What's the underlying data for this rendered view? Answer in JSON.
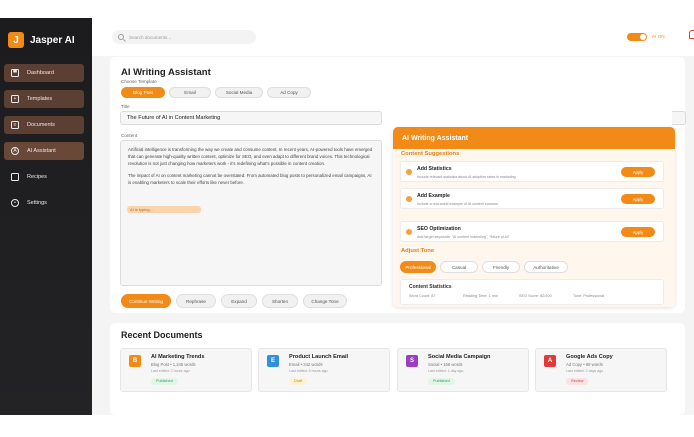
{
  "app": {
    "brand_initial": "J",
    "brand_name": "Jasper AI"
  },
  "colors": {
    "accent": "#f28a18",
    "sidebar_bg": "#1c1c1e",
    "nav_active": "#6a4838"
  },
  "sidebar": {
    "items": [
      {
        "label": "Dashboard",
        "icon": "dashboard-icon"
      },
      {
        "label": "Templates",
        "icon": "plus-square-icon"
      },
      {
        "label": "Documents",
        "icon": "document-icon"
      },
      {
        "label": "AI Assistant",
        "icon": "ai-icon"
      },
      {
        "label": "Recipes",
        "icon": "recipe-icon"
      },
      {
        "label": "Settings",
        "icon": "gear-icon"
      }
    ]
  },
  "topbar": {
    "search_placeholder": "Search documents...",
    "ai_toggle_label": "AI ON",
    "ai_toggle_on": true
  },
  "assistant": {
    "title": "AI Writing Assistant",
    "choose_template_label": "Choose Template",
    "templates": [
      "Blog Post",
      "Email",
      "Social Media",
      "Ad Copy"
    ],
    "selected_template": "Blog Post",
    "title_label": "Title",
    "title_value": "The Future of AI in Content Marketing",
    "content_label": "Content",
    "content_p1": "Artificial intelligence is transforming the way we create and consume content. In recent years, AI-powered tools have emerged that can generate high-quality written content, optimize for SEO, and even adapt to different brand voices. This technological revolution is not just changing how marketers work - it's redefining what's possible in content creation.",
    "content_p2": "The impact of AI on content marketing cannot be overstated. From automated blog posts to personalized email campaigns, AI is enabling marketers to scale their efforts like never before.",
    "typing_indicator": "AI is typing...",
    "actions": [
      "Continue Writing",
      "Rephrase",
      "Expand",
      "Shorten",
      "Change Tone"
    ]
  },
  "panel": {
    "title": "AI Writing Assistant",
    "suggestions_heading": "Content Suggestions",
    "suggestions": [
      {
        "title": "Add Statistics",
        "desc": "Include relevant statistics about AI adoption rates in marketing",
        "button": "Apply"
      },
      {
        "title": "Add Example",
        "desc": "Include a real-world example of AI content success",
        "button": "Apply"
      },
      {
        "title": "SEO Optimization",
        "desc": "Add target keywords: \"AI content marketing\", \"future of AI\"",
        "button": "Apply"
      }
    ],
    "tone_heading": "Adjust Tone",
    "tones": [
      "Professional",
      "Casual",
      "Friendly",
      "Authoritative"
    ],
    "selected_tone": "Professional",
    "stats_title": "Content Statistics",
    "stats": [
      "Word Count: 87",
      "Reading Time: 1 min",
      "SEO Score: 82/100",
      "Tone: Professional"
    ]
  },
  "recent": {
    "title": "Recent Documents",
    "docs": [
      {
        "icon_letter": "B",
        "icon_color": "#f28a18",
        "title": "AI Marketing Trends",
        "meta": "Blog Post • 1,245 words",
        "edited": "Last edited: 2 hours ago",
        "badge": "Published",
        "badge_bg": "#e2f5e6",
        "badge_fg": "#3a9a52"
      },
      {
        "icon_letter": "E",
        "icon_color": "#2f8fe0",
        "title": "Product Launch Email",
        "meta": "Email • 342 words",
        "edited": "Last edited: 5 hours ago",
        "badge": "Draft",
        "badge_bg": "#fff1d6",
        "badge_fg": "#c98a1c"
      },
      {
        "icon_letter": "S",
        "icon_color": "#9b3ec0",
        "title": "Social Media Campaign",
        "meta": "Social • 156 words",
        "edited": "Last edited: 1 day ago",
        "badge": "Published",
        "badge_bg": "#e2f5e6",
        "badge_fg": "#3a9a52"
      },
      {
        "icon_letter": "A",
        "icon_color": "#e23a3a",
        "title": "Google Ads Copy",
        "meta": "Ad Copy • 89 words",
        "edited": "Last edited: 2 days ago",
        "badge": "Review",
        "badge_bg": "#fde2e2",
        "badge_fg": "#d24646"
      }
    ]
  }
}
